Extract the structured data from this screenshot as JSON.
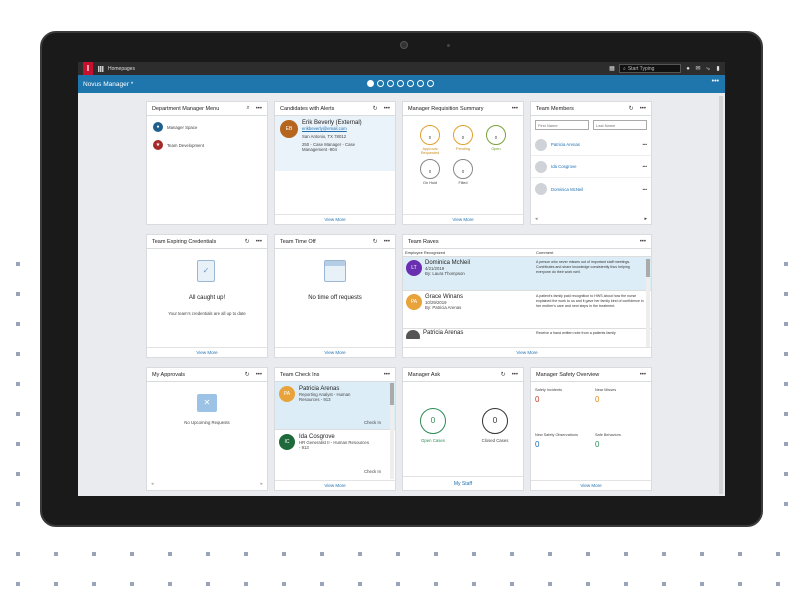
{
  "app": {
    "breadcrumb": "Homepages",
    "search_placeholder": "Start Typing",
    "title": "Novus Manager *"
  },
  "cards": {
    "dept_menu": {
      "title": "Department Manager Menu",
      "items": [
        "Manager Space",
        "Team Development"
      ]
    },
    "candidates": {
      "title": "Candidates with Alerts",
      "initials": "EB",
      "name": "Erik Beverly (External)",
      "email": "erikbeverly@email.com",
      "location": "San Antonio, TX 78012",
      "req": "250 - Case Manager - Case",
      "req2": "Management -904",
      "view_more": "View More"
    },
    "req_summary": {
      "title": "Manager Requisition Summary",
      "rows": [
        {
          "value": "0",
          "label": "Approval Requested"
        },
        {
          "value": "0",
          "label": "Pending"
        },
        {
          "value": "0",
          "label": "Open"
        },
        {
          "value": "0",
          "label": "On Hold"
        },
        {
          "value": "0",
          "label": "Filled"
        }
      ],
      "view_more": "View More"
    },
    "team_members": {
      "title": "Team Members",
      "first_placeholder": "First Name",
      "last_placeholder": "Last Name",
      "members": [
        "Patricia Arenas",
        "Ida Cosgrove",
        "Dominica McNeil"
      ]
    },
    "expiring": {
      "title": "Team Expiring Credentials",
      "heading": "All caught up!",
      "sub": "Your team's credentials are all up to date",
      "view_more": "View More"
    },
    "time_off": {
      "title": "Team Time Off",
      "heading": "No time off requests",
      "view_more": "View More"
    },
    "raves": {
      "title": "Team Raves",
      "col1": "Employee Recognized",
      "col2": "Comment",
      "rows": [
        {
          "initials": "LT",
          "name": "Dominica McNeil",
          "date": "4/21/2019",
          "by": "By: Laura Thompson",
          "comment": "A person who never misses out of important staff meetings. Contributes and share knowledge consistently thus helping everyone do their work well."
        },
        {
          "initials": "PA",
          "name": "Grace Winans",
          "date": "10/29/2019",
          "by": "By: Patricia Arenas",
          "comment": "A patient's family paid recognition to HWS about how the nurse explained the work to us and it gave her family kind of confidence in her mother's care and next steps in the treatment."
        },
        {
          "initials": "PA",
          "name": "Patricia Arenas",
          "date": "",
          "by": "",
          "comment": "Receive a hand written note from a patients family"
        }
      ],
      "view_more": "View More"
    },
    "approvals": {
      "title": "My Approvals",
      "text": "No Upcoming Requests"
    },
    "checkins": {
      "title": "Team Check Ins",
      "items": [
        {
          "initials": "PA",
          "name": "Patricia Arenas",
          "role": "Reporting Analyst - Human",
          "role2": "Resources - 913",
          "action": "Check In"
        },
        {
          "initials": "IC",
          "name": "Ida Cosgrove",
          "role": "HR Generalist II - Human Resources",
          "role2": "- 913",
          "action": "Check In"
        }
      ],
      "view_more": "View More"
    },
    "ask": {
      "title": "Manager Ask",
      "open_value": "0",
      "open_label": "Open Cases",
      "closed_value": "0",
      "closed_label": "Closed Cases",
      "link": "My Staff"
    },
    "safety": {
      "title": "Manager Safety Overview",
      "items": [
        {
          "label": "Safety Incidents",
          "value": "0"
        },
        {
          "label": "Near Misses",
          "value": "0"
        },
        {
          "label": "New Safety Observations",
          "value": "0"
        },
        {
          "label": "Safe Behaviors",
          "value": "0"
        }
      ],
      "view_more": "View More"
    }
  },
  "colors": {
    "brand_red": "#c8102e",
    "header_blue": "#1f76ad",
    "link_blue": "#1f6fb0"
  }
}
